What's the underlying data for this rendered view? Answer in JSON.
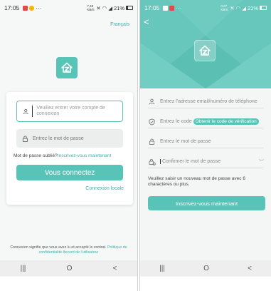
{
  "colors": {
    "accent": "#58c4b8",
    "accent_text": "#3ab3a8",
    "header": "#67c7bc"
  },
  "left": {
    "status": {
      "time": "17:05",
      "dots": "···",
      "signal": "7,48 KB/S",
      "battery": "21%"
    },
    "language": "Français",
    "logo": "house-logo-icon",
    "account_placeholder": "Veuillez entrer votre compte de connexion",
    "password_placeholder": "Entrez le mot de passe",
    "forgot": "Mot de passe oublié?",
    "register_link": "Inscrivez-vous maintenant",
    "login_button": "Vous connectez",
    "local_login": "Connexion locale",
    "terms_text": "Connexion signifie que vous avez lu et accepté le contrat.",
    "terms_link_privacy": "Politique de confidentialité",
    "terms_link_agreement": "Accord de l'utilisateur",
    "nav": {
      "recent": "|||",
      "home": "O",
      "back": "<"
    }
  },
  "right": {
    "status": {
      "time": "17:05",
      "dots": "···",
      "signal": "0,07 KB/S",
      "battery": "21%"
    },
    "back": "<",
    "email_placeholder": "Entrez l'adresse email/numéro de téléphone",
    "code_placeholder": "Entrez le code",
    "get_code_button": "Obtenir le code de vérification",
    "password_placeholder": "Entrez le mot de passe",
    "confirm_placeholder": "Confirmer le mot de passe",
    "hint": "Veuillez saisir un nouveau mot de passe avec 6 charactères ou plus.",
    "register_button": "Inscrivez-vous maintenant",
    "nav": {
      "recent": "|||",
      "home": "O",
      "back": "<"
    }
  }
}
